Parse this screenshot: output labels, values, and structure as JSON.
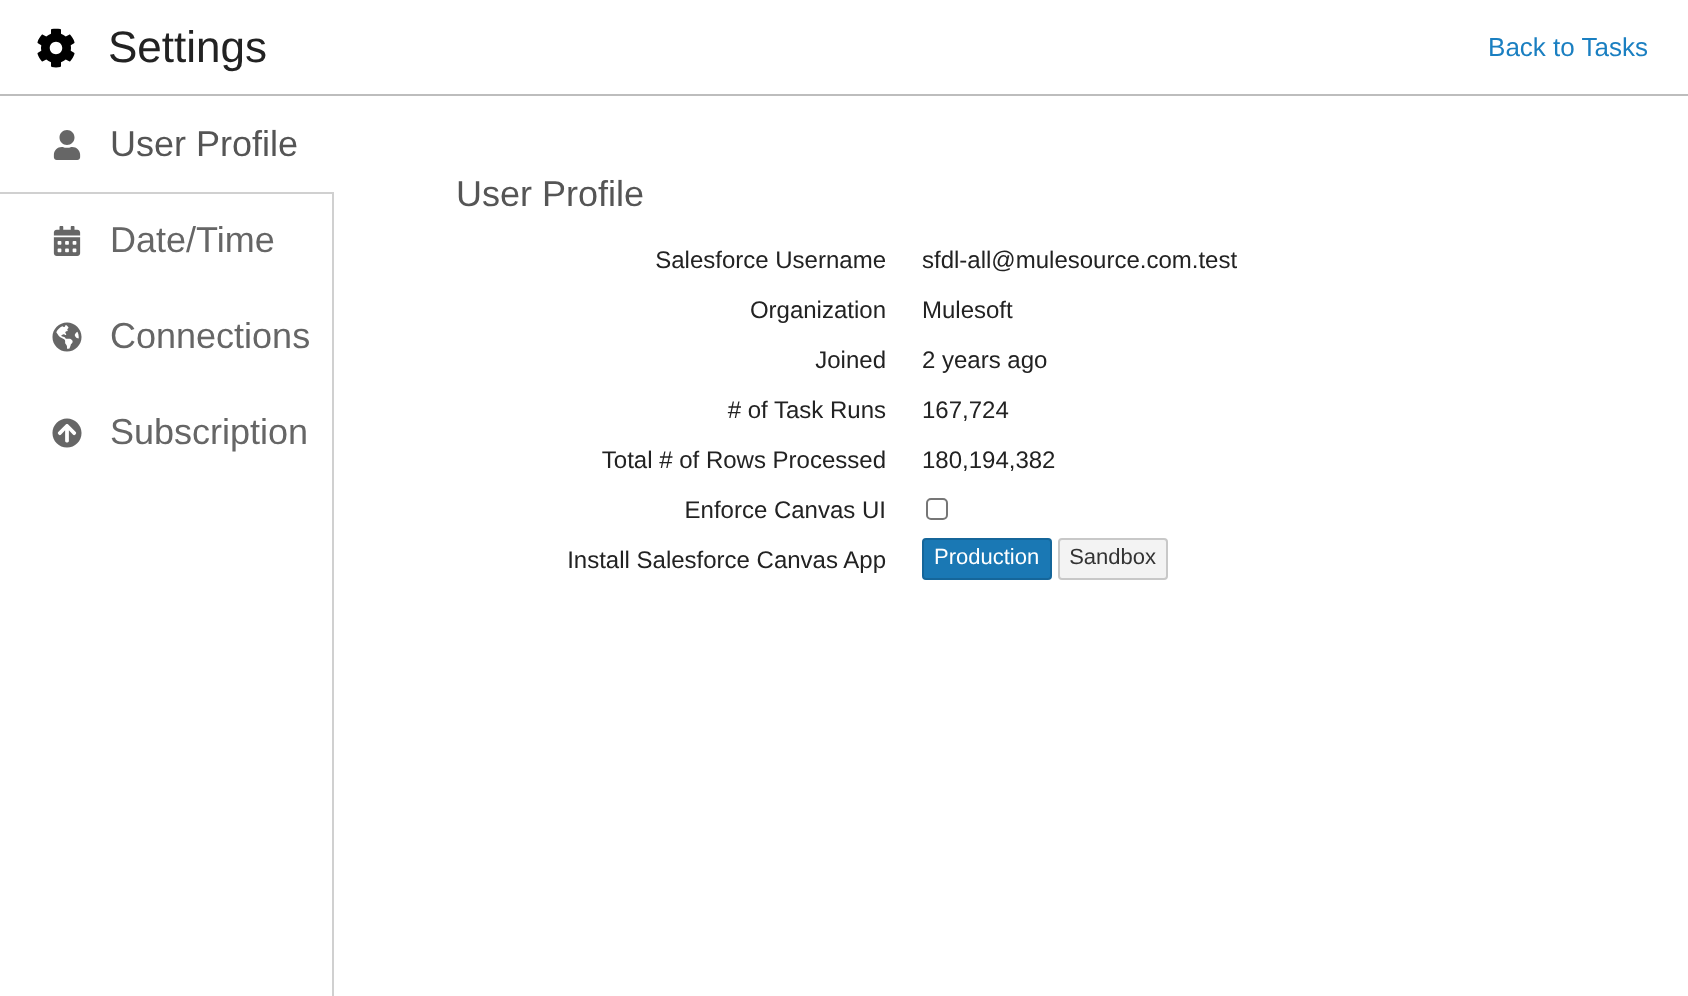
{
  "header": {
    "title": "Settings",
    "back_link": "Back to Tasks"
  },
  "sidebar": {
    "items": [
      {
        "label": "User Profile",
        "selected": true
      },
      {
        "label": "Date/Time",
        "selected": false
      },
      {
        "label": "Connections",
        "selected": false
      },
      {
        "label": "Subscription",
        "selected": false
      }
    ]
  },
  "section": {
    "title": "User Profile",
    "rows": [
      {
        "kind": "text",
        "label": "Salesforce Username",
        "value": "sfdl-all@mulesource.com.test"
      },
      {
        "kind": "text",
        "label": "Organization",
        "value": "Mulesoft"
      },
      {
        "kind": "text",
        "label": "Joined",
        "value": "2 years ago"
      },
      {
        "kind": "text",
        "label": "# of Task Runs",
        "value": "167,724"
      },
      {
        "kind": "text",
        "label": "Total # of Rows Processed",
        "value": "180,194,382"
      },
      {
        "kind": "checkbox",
        "label": "Enforce Canvas UI",
        "checked": false
      },
      {
        "kind": "buttons",
        "label": "Install Salesforce Canvas App",
        "buttons": [
          {
            "label": "Production",
            "primary": true
          },
          {
            "label": "Sandbox",
            "primary": false
          }
        ]
      }
    ]
  }
}
